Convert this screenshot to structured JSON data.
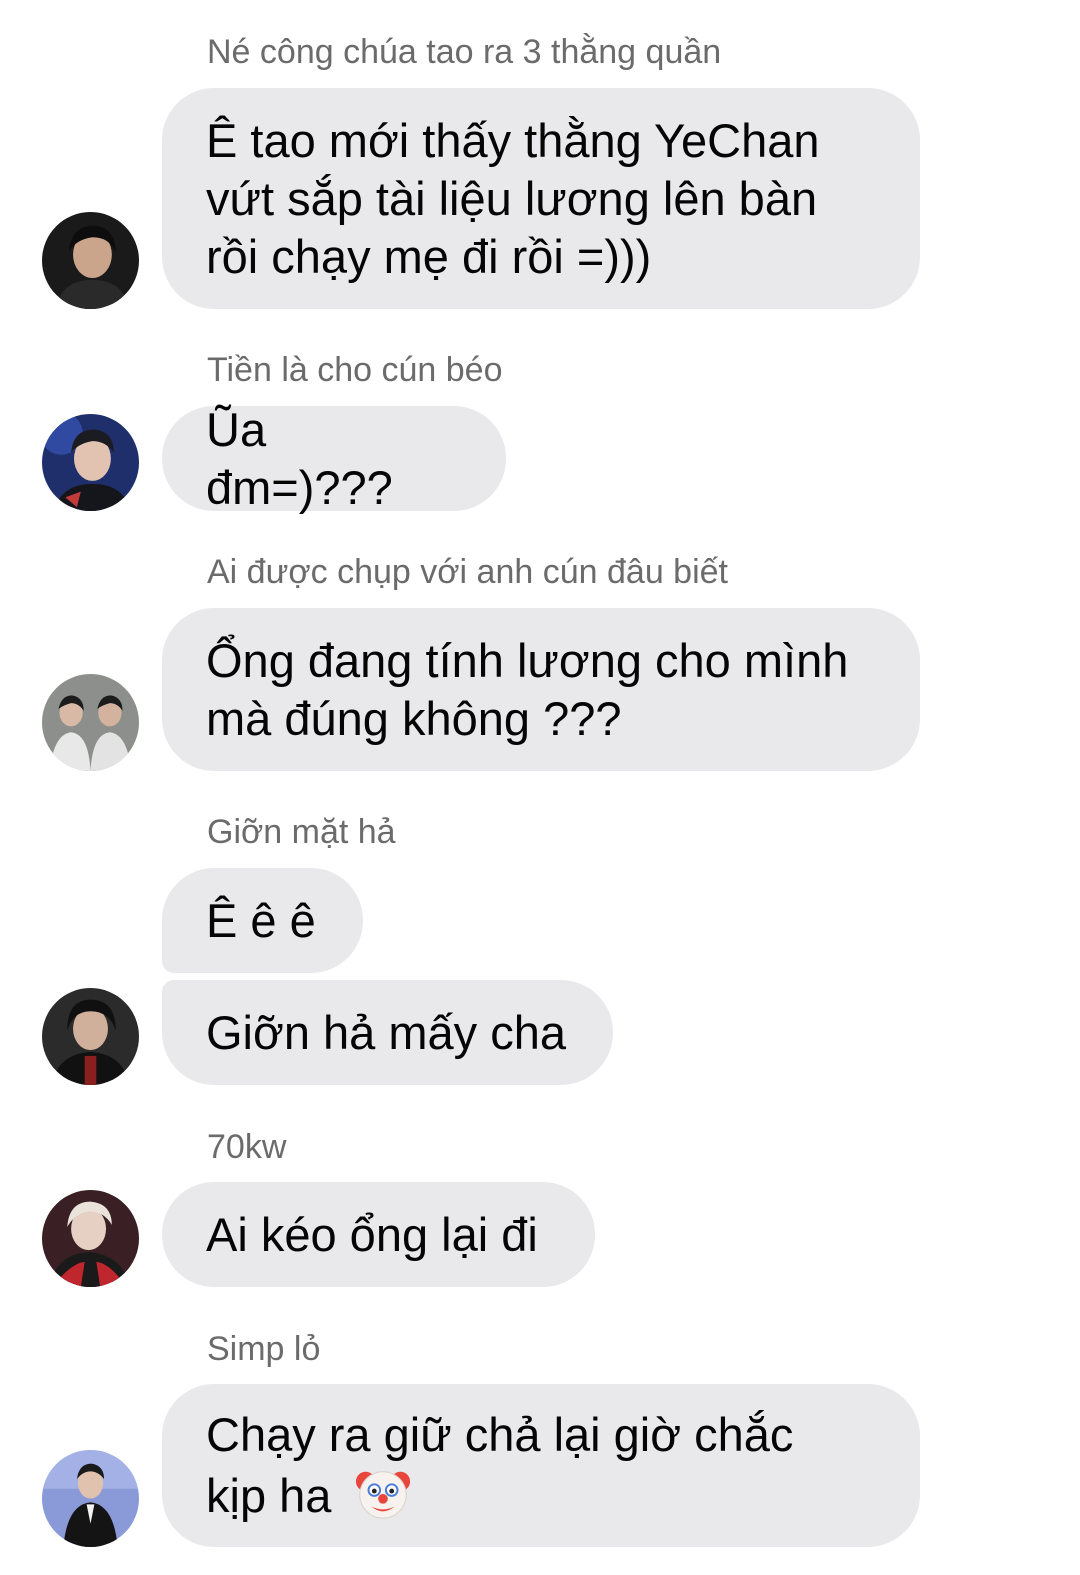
{
  "messages": [
    {
      "sender": "Né công chúa tao ra 3 thằng quần",
      "lines": [
        "Ê tao mới thấy thằng YeChan vứt sắp tài liệu lương lên bàn rồi chạy mẹ đi rồi =)))"
      ],
      "avatar": "avatar-dark-hair"
    },
    {
      "sender": "Tiền là cho cún béo",
      "lines": [
        "Ũa đm=)???"
      ],
      "avatar": "avatar-stage-light"
    },
    {
      "sender": "Ai được chụp với anh cún đâu biết",
      "lines": [
        "Ổng đang tính lương cho mình mà đúng không ???"
      ],
      "avatar": "avatar-group-photo"
    },
    {
      "sender": "Giỡn mặt hả",
      "lines": [
        "Ê ê ê",
        "Giỡn hả mấy cha"
      ],
      "avatar": "avatar-black-jacket"
    },
    {
      "sender": "70kw",
      "lines": [
        "Ai kéo ổng lại đi"
      ],
      "avatar": "avatar-red-jersey"
    },
    {
      "sender": "Simp lỏ",
      "lines": [
        "Chạy ra giữ chả lại giờ chắc kịp ha"
      ],
      "emoji": "clown-face-icon",
      "avatar": "avatar-suit"
    }
  ],
  "colors": {
    "bubble": "#e9e9eb",
    "sender_text": "#6b6b6b",
    "message_text": "#050505",
    "background": "#ffffff"
  }
}
